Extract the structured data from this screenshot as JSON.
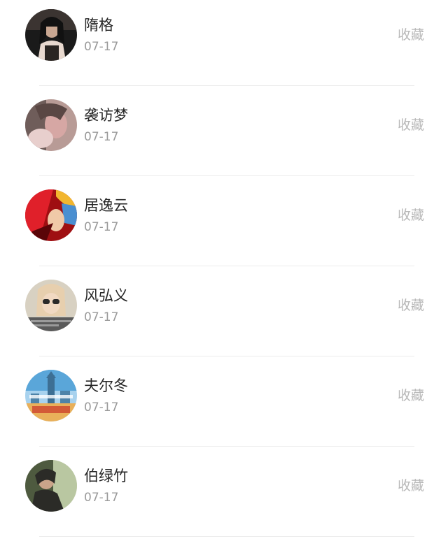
{
  "items": [
    {
      "name": "隋格",
      "date": "07-17",
      "action": "收藏",
      "avatar": {
        "icon": "avatar-portrait-dark",
        "colors": [
          "#1a1a1a",
          "#3b3431",
          "#c9a792",
          "#e8d9cf"
        ]
      }
    },
    {
      "name": "袭访梦",
      "date": "07-17",
      "action": "收藏",
      "avatar": {
        "icon": "avatar-portrait-pink",
        "colors": [
          "#6f5d5a",
          "#b89b96",
          "#d6a7a4",
          "#e8cfcd"
        ]
      }
    },
    {
      "name": "居逸云",
      "date": "07-17",
      "action": "收藏",
      "avatar": {
        "icon": "avatar-anime-red",
        "colors": [
          "#9f0f12",
          "#e0202a",
          "#f2b62f",
          "#4a8fd1"
        ]
      }
    },
    {
      "name": "风弘义",
      "date": "07-17",
      "action": "收藏",
      "avatar": {
        "icon": "avatar-child-sunglasses",
        "colors": [
          "#d8d1c2",
          "#e7cfae",
          "#2a2a2a",
          "#5a5a5a"
        ]
      }
    },
    {
      "name": "夫尔冬",
      "date": "07-17",
      "action": "收藏",
      "avatar": {
        "icon": "avatar-city-blue",
        "colors": [
          "#5aa6d9",
          "#a8d2ee",
          "#d35a37",
          "#e9b05a"
        ]
      }
    },
    {
      "name": "伯绿竹",
      "date": "07-17",
      "action": "收藏",
      "avatar": {
        "icon": "avatar-portrait-outdoor",
        "colors": [
          "#2b2b27",
          "#4e5a3f",
          "#b9c7a1",
          "#e7e1d0"
        ]
      }
    }
  ]
}
